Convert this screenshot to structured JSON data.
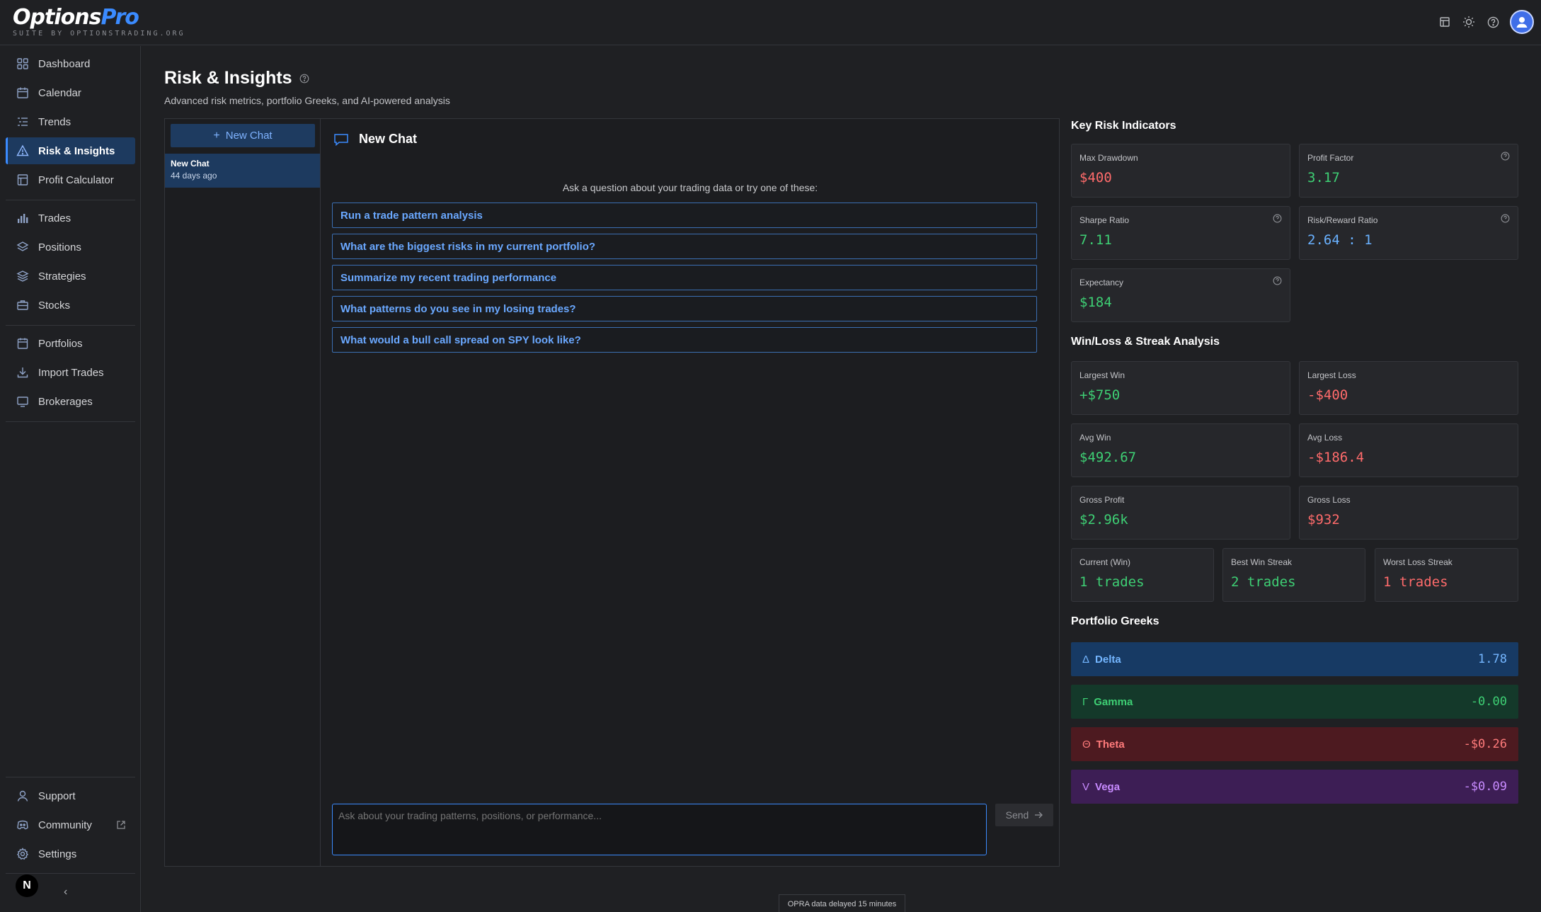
{
  "app": {
    "logo_part1": "Options",
    "logo_part2": "Pro",
    "logo_sub": "SUITE BY OPTIONSTRADING.ORG"
  },
  "sidebar": {
    "items": [
      {
        "label": "Dashboard",
        "icon": "dashboard-icon"
      },
      {
        "label": "Calendar",
        "icon": "calendar-icon"
      },
      {
        "label": "Trends",
        "icon": "trends-icon"
      },
      {
        "label": "Risk & Insights",
        "icon": "warning-triangle-icon",
        "active": true
      },
      {
        "label": "Profit Calculator",
        "icon": "calculator-icon"
      },
      {
        "label": "Trades",
        "icon": "bar-chart-icon"
      },
      {
        "label": "Positions",
        "icon": "layers-icon"
      },
      {
        "label": "Strategies",
        "icon": "stack-icon"
      },
      {
        "label": "Stocks",
        "icon": "briefcase-icon"
      },
      {
        "label": "Portfolios",
        "icon": "folder-icon"
      },
      {
        "label": "Import Trades",
        "icon": "download-icon"
      },
      {
        "label": "Brokerages",
        "icon": "monitor-icon"
      }
    ],
    "bottom": [
      {
        "label": "Support",
        "icon": "user-headset-icon"
      },
      {
        "label": "Community",
        "icon": "discord-icon"
      },
      {
        "label": "Settings",
        "icon": "gear-icon"
      }
    ],
    "user_initial": "N",
    "collapse_glyph": "‹"
  },
  "page": {
    "title": "Risk & Insights",
    "subtitle": "Advanced risk metrics, portfolio Greeks, and AI-powered analysis"
  },
  "chat": {
    "new_chat_label": "New Chat",
    "history": [
      {
        "title": "New Chat",
        "date": "44 days ago"
      }
    ],
    "header_title": "New Chat",
    "hint": "Ask a question about your trading data or try one of these:",
    "suggestions": [
      "Run a trade pattern analysis",
      "What are the biggest risks in my current portfolio?",
      "Summarize my recent trading performance",
      "What patterns do you see in my losing trades?",
      "What would a bull call spread on SPY look like?"
    ],
    "input_placeholder": "Ask about your trading patterns, positions, or performance...",
    "send_label": "Send"
  },
  "risk": {
    "title": "Key Risk Indicators",
    "max_drawdown": {
      "label": "Max Drawdown",
      "value": "$400"
    },
    "profit_factor": {
      "label": "Profit Factor",
      "value": "3.17"
    },
    "sharpe": {
      "label": "Sharpe Ratio",
      "value": "7.11"
    },
    "rr": {
      "label": "Risk/Reward Ratio",
      "value": "2.64 : 1"
    },
    "expectancy": {
      "label": "Expectancy",
      "value": "$184"
    }
  },
  "winloss": {
    "title": "Win/Loss & Streak Analysis",
    "largest_win": {
      "label": "Largest Win",
      "value": "+$750"
    },
    "largest_loss": {
      "label": "Largest Loss",
      "value": "-$400"
    },
    "avg_win": {
      "label": "Avg Win",
      "value": "$492.67"
    },
    "avg_loss": {
      "label": "Avg Loss",
      "value": "-$186.4"
    },
    "gross_profit": {
      "label": "Gross Profit",
      "value": "$2.96k"
    },
    "gross_loss": {
      "label": "Gross Loss",
      "value": "$932"
    },
    "current": {
      "label": "Current (Win)",
      "value": "1 trades"
    },
    "best_streak": {
      "label": "Best Win Streak",
      "value": "2 trades"
    },
    "worst_streak": {
      "label": "Worst Loss Streak",
      "value": "1 trades"
    }
  },
  "greeks": {
    "title": "Portfolio Greeks",
    "items": [
      {
        "symbol": "Δ",
        "name": "Delta",
        "value": "1.78"
      },
      {
        "symbol": "Γ",
        "name": "Gamma",
        "value": "-0.00"
      },
      {
        "symbol": "Θ",
        "name": "Theta",
        "value": "-$0.26"
      },
      {
        "symbol": "V",
        "name": "Vega",
        "value": "-$0.09"
      }
    ]
  },
  "footer": {
    "opra_notice": "OPRA data delayed 15 minutes"
  },
  "colors": {
    "accent": "#3b8bff",
    "positive": "#3ecf74",
    "negative": "#ff6b6b",
    "background": "#1f2023"
  }
}
